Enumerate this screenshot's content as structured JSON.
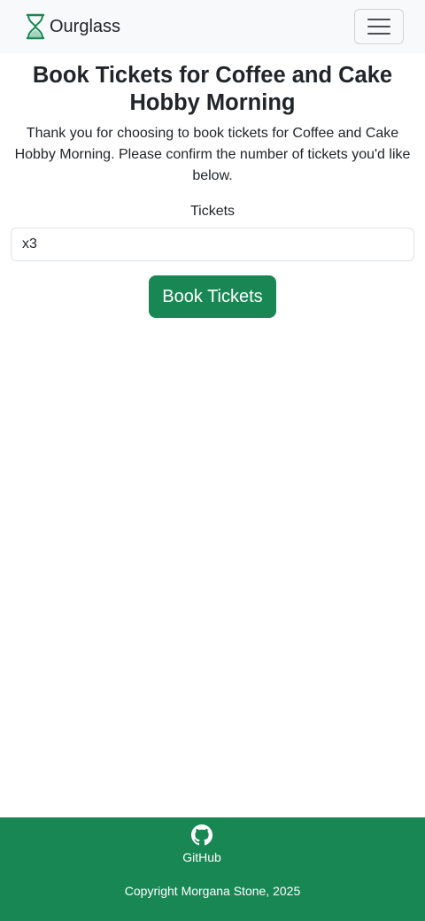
{
  "navbar": {
    "brand_name": "Ourglass",
    "brand_icon": "hourglass-icon",
    "menu_icon": "hamburger-menu-icon"
  },
  "main": {
    "title": "Book Tickets for Coffee and Cake Hobby Morning",
    "intro": "Thank you for choosing to book tickets for Coffee and Cake Hobby Morning. Please confirm the number of tickets you'd like below.",
    "tickets_label": "Tickets",
    "tickets_value": "x3",
    "submit_label": "Book Tickets"
  },
  "footer": {
    "github_label": "GitHub",
    "github_icon": "github-icon",
    "copyright": "Copyright Morgana Stone, 2025"
  },
  "colors": {
    "brand_green": "#198754",
    "navbar_bg": "#f8f9fa",
    "text": "#212529"
  }
}
